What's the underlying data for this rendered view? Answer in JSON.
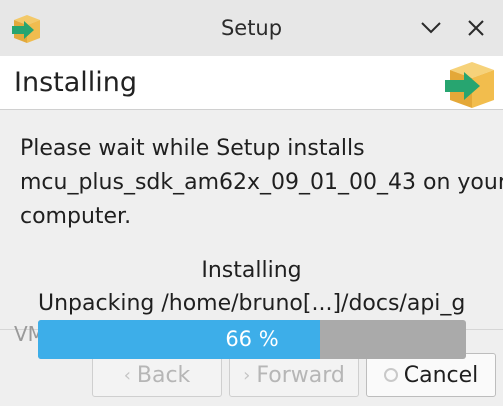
{
  "window": {
    "title": "Setup"
  },
  "header": {
    "heading": "Installing"
  },
  "message": {
    "lines": [
      "Please wait while Setup installs",
      "mcu_plus_sdk_am62x_09_01_00_43 on your",
      "computer."
    ]
  },
  "status": {
    "label": "Installing",
    "detail": "Unpacking /home/bruno[...]/docs/api_g"
  },
  "background": {
    "partial_label": "VM"
  },
  "progress": {
    "value": 0.66,
    "label": "66 %",
    "fill_color": "#3daee9",
    "track_color": "#aaaaaa"
  },
  "buttons": {
    "back": "Back",
    "forward": "Forward",
    "cancel": "Cancel"
  },
  "icons": {
    "app": "package-arrow-icon",
    "minimize": "chevron-down-icon",
    "close": "close-icon",
    "back": "chevron-left-icon",
    "forward": "chevron-right-icon",
    "cancel": "cancel-icon"
  }
}
